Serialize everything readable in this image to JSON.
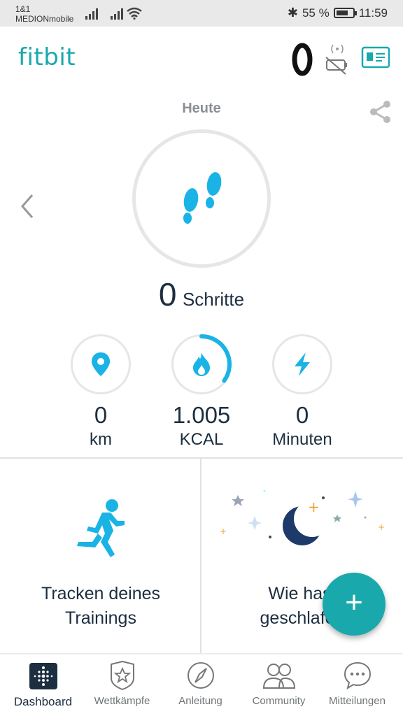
{
  "status_bar": {
    "carrier_line1": "1&1",
    "carrier_line2": "MEDIONmobile",
    "battery_percent": "55 %",
    "time": "11:59"
  },
  "header": {
    "logo": "fitbit",
    "icons": [
      "tracker-band-icon",
      "sync-off-icon",
      "profile-card-icon"
    ]
  },
  "dashboard": {
    "date_label": "Heute",
    "steps": {
      "value": "0",
      "label": "Schritte"
    },
    "stats": [
      {
        "icon": "location-pin-icon",
        "value": "0",
        "unit": "km",
        "progress": 0
      },
      {
        "icon": "flame-icon",
        "value": "1.005",
        "unit": "KCAL",
        "progress": 0.35
      },
      {
        "icon": "lightning-icon",
        "value": "0",
        "unit": "Minuten",
        "progress": 0
      }
    ],
    "accent_color": "#19a9ac",
    "icon_color": "#1ab3e6"
  },
  "tiles": {
    "exercise_line1": "Tracken deines",
    "exercise_line2": "Trainings",
    "sleep_line1": "Wie hast",
    "sleep_line2": "geschlafen"
  },
  "fab": {
    "label": "+"
  },
  "nav": {
    "items": [
      {
        "label": "Dashboard",
        "icon": "dashboard-icon",
        "active": true
      },
      {
        "label": "Wettkämpfe",
        "icon": "challenges-star-icon",
        "active": false
      },
      {
        "label": "Anleitung",
        "icon": "compass-icon",
        "active": false
      },
      {
        "label": "Community",
        "icon": "community-icon",
        "active": false
      },
      {
        "label": "Mitteilungen",
        "icon": "messages-icon",
        "active": false
      }
    ]
  }
}
